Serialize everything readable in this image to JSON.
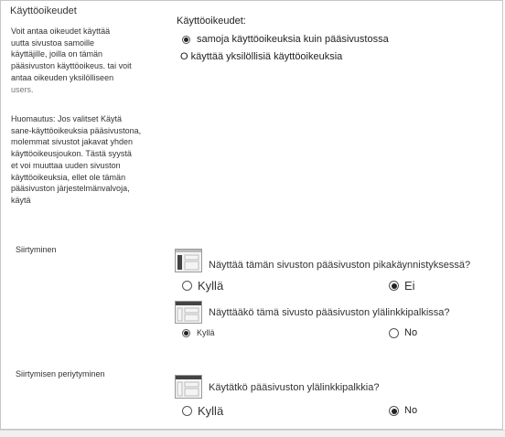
{
  "permissions": {
    "section_title": "Käyttöoikeudet",
    "desc_lines": [
      "Voit antaa oikeudet käyttää",
      "uutta sivustoa samoille",
      "käyttäjille, joilla on tämän",
      "pääsivuston käyttöoikeus. tai voit",
      "antaa oikeuden yksilölliseen"
    ],
    "desc_gray": "users.",
    "note_lines": [
      "Huomautus: Jos valitset Käytä",
      "sane-käyttöoikeuksia pääsivustona,",
      "molemmat sivustot jakavat yhden",
      "käyttöoikeusjoukon. Tästä syystä",
      "et voi muuttaa uuden sivuston",
      "käyttöoikeuksia, ellet ole tämän",
      "pääsivuston järjestelmänvalvoja,",
      "käytä"
    ],
    "field_label": "Käyttöoikeudet:",
    "option_same": "samoja käyttöoikeuksia kuin pääsivustossa",
    "option_unique": "O käyttää yksilöllisiä käyttöoikeuksia"
  },
  "navigation": {
    "section_title": "Siirtyminen",
    "q1": "Näyttää tämän sivuston pääsivuston pikakäynnistyksessä?",
    "q1_yes": "Kyllä",
    "q1_no": "Ei",
    "q2": "Näyttääkö tämä sivusto pääsivuston ylälinkkipalkissa?",
    "q2_yes": "Kyllä",
    "q2_no": "No"
  },
  "inheritance": {
    "section_title": "Siirtymisen periytyminen",
    "q": "Käytätkö pääsivuston ylälinkkipalkkia?",
    "yes": "Kyllä",
    "no": "No"
  },
  "icons": [
    "quick-launch-icon",
    "top-link-bar-icon",
    "top-link-bar-inherit-icon"
  ]
}
